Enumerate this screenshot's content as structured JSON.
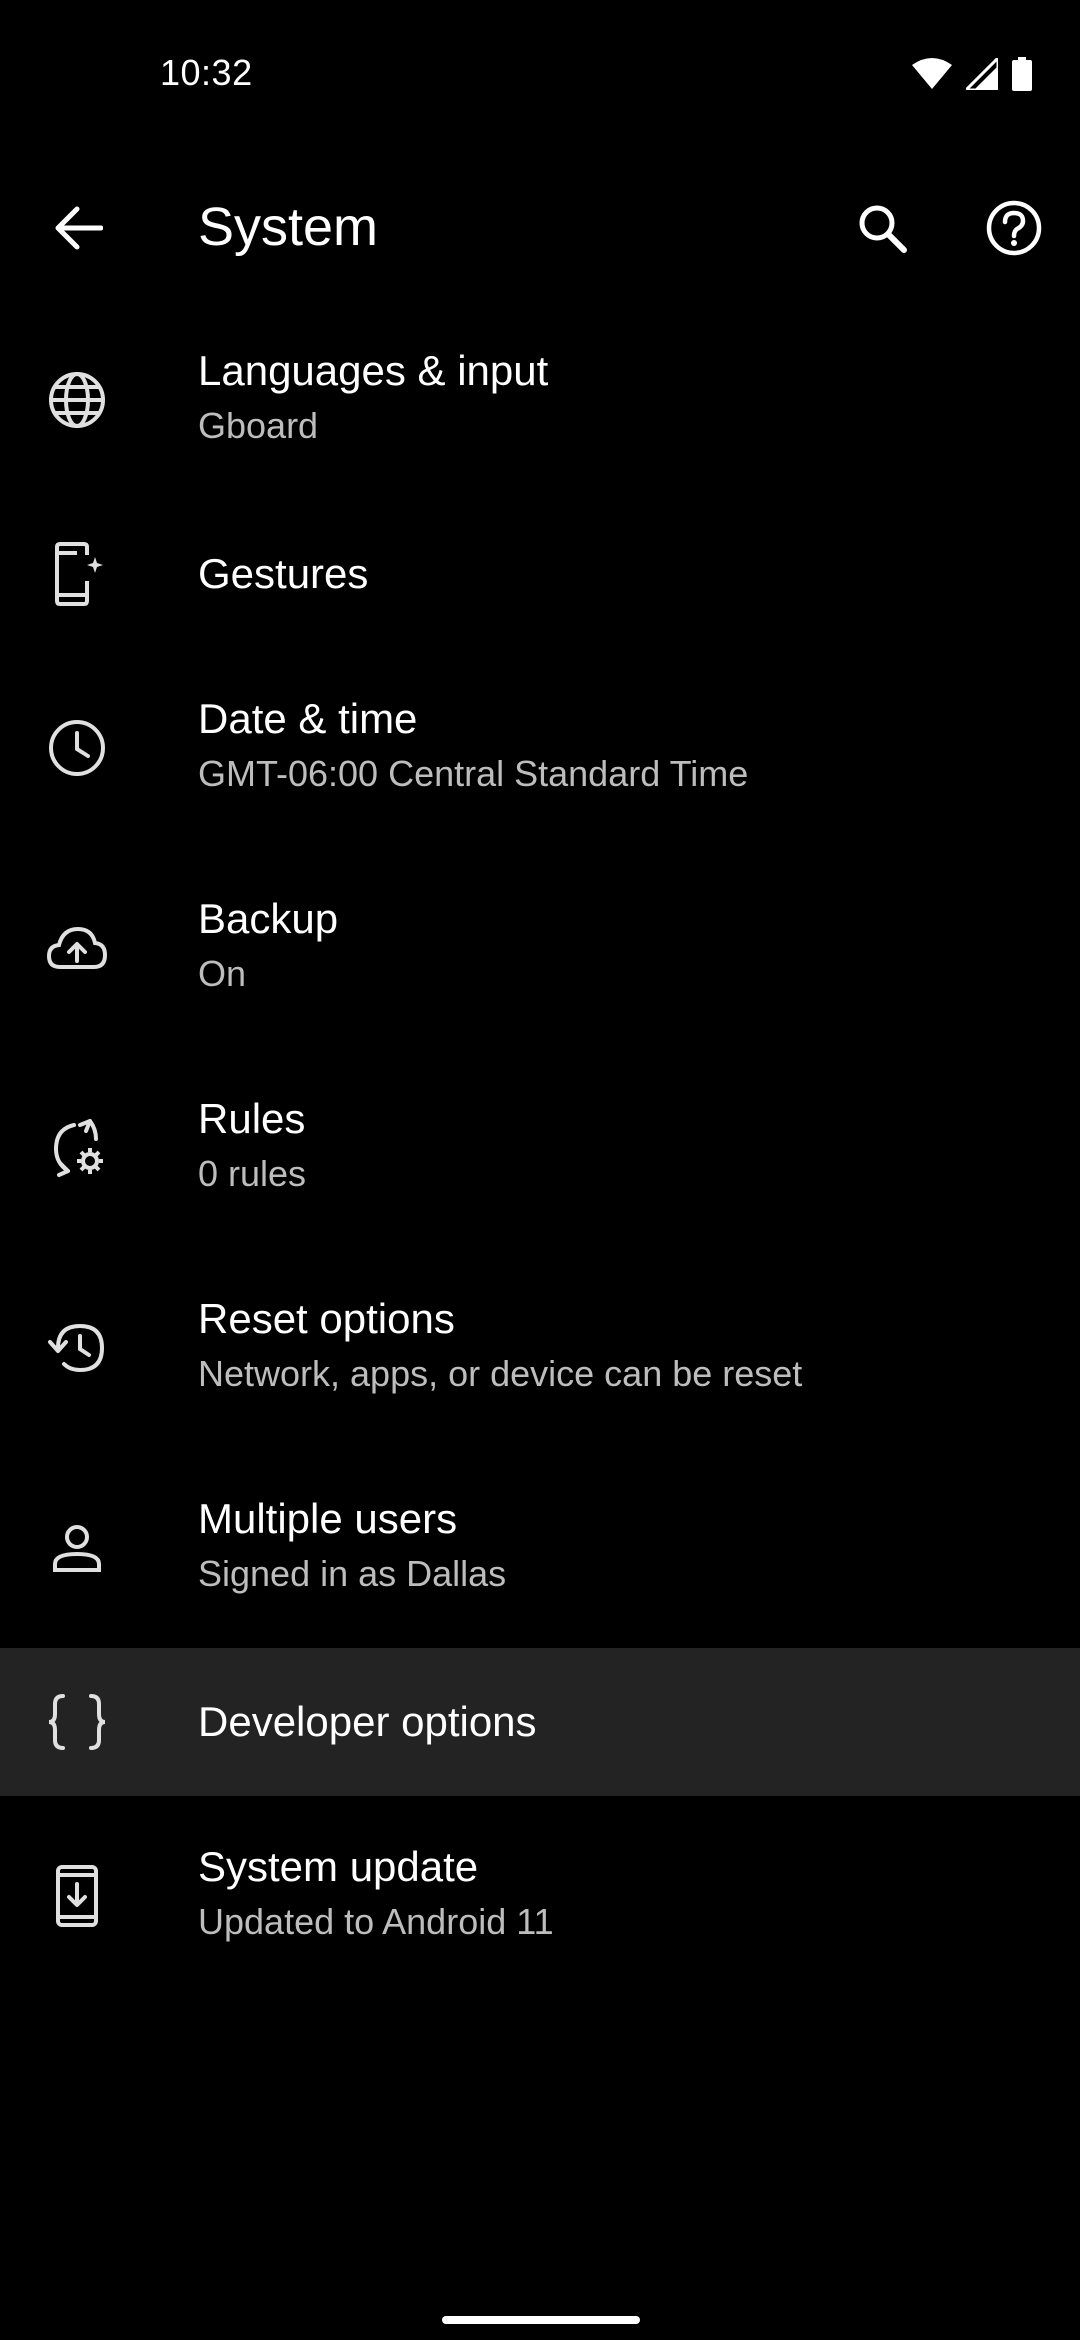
{
  "status_bar": {
    "time": "10:32"
  },
  "app_bar": {
    "title": "System"
  },
  "items": [
    {
      "title": "Languages & input",
      "summary": "Gboard",
      "icon": "globe-icon"
    },
    {
      "title": "Gestures",
      "summary": "",
      "icon": "gestures-icon"
    },
    {
      "title": "Date & time",
      "summary": "GMT-06:00 Central Standard Time",
      "icon": "clock-icon"
    },
    {
      "title": "Backup",
      "summary": "On",
      "icon": "cloud-upload-icon"
    },
    {
      "title": "Rules",
      "summary": "0 rules",
      "icon": "rules-icon"
    },
    {
      "title": "Reset options",
      "summary": "Network, apps, or device can be reset",
      "icon": "restore-icon"
    },
    {
      "title": "Multiple users",
      "summary": "Signed in as Dallas",
      "icon": "person-icon"
    },
    {
      "title": "Developer options",
      "summary": "",
      "icon": "code-braces-icon"
    },
    {
      "title": "System update",
      "summary": "Updated to Android 11",
      "icon": "system-update-icon"
    }
  ],
  "colors": {
    "background": "#000000",
    "primary_text": "#ffffff",
    "secondary_text": "#bdbdbd",
    "highlight": "#232323",
    "icon": "#e0e0e0"
  }
}
